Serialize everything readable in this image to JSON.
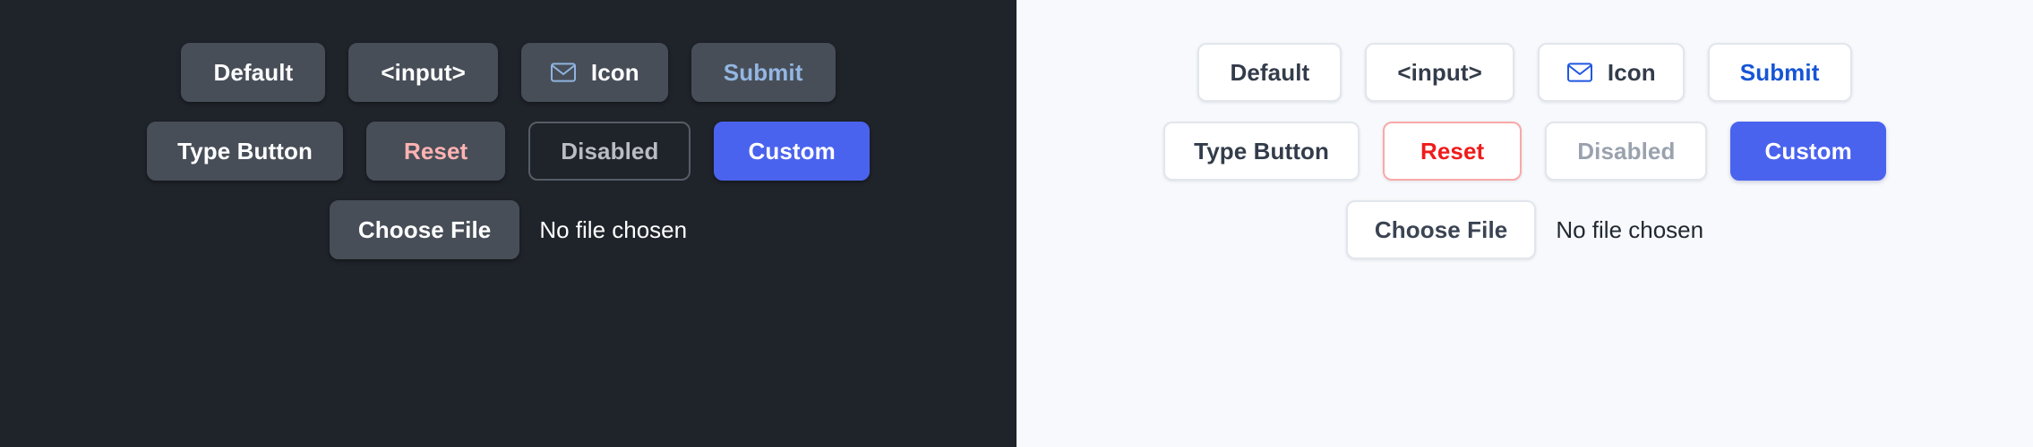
{
  "panels": [
    {
      "theme": "dark",
      "background_color": "#1f232a",
      "rows": [
        {
          "buttons": [
            {
              "label": "Default",
              "style": "solid",
              "icon": null
            },
            {
              "label": "<input>",
              "style": "solid",
              "icon": null
            },
            {
              "label": "Icon",
              "style": "solid",
              "icon": "envelope-icon",
              "icon_color": "#8fb4df"
            },
            {
              "label": "Submit",
              "style": "submit",
              "icon": null,
              "text_color": "#94b6e2"
            }
          ]
        },
        {
          "buttons": [
            {
              "label": "Type Button",
              "style": "solid",
              "icon": null
            },
            {
              "label": "Reset",
              "style": "reset",
              "icon": null,
              "text_color": "#ffb3b3"
            },
            {
              "label": "Disabled",
              "style": "disabled",
              "icon": null,
              "text_color": "#b9bcc1"
            },
            {
              "label": "Custom",
              "style": "custom",
              "icon": null,
              "background_color": "#4a63ee"
            }
          ]
        }
      ],
      "file_input": {
        "button_label": "Choose File",
        "status_text": "No file chosen"
      }
    },
    {
      "theme": "light",
      "background_color": "#f7f9fc",
      "rows": [
        {
          "buttons": [
            {
              "label": "Default",
              "style": "solid",
              "icon": null
            },
            {
              "label": "<input>",
              "style": "solid",
              "icon": null
            },
            {
              "label": "Icon",
              "style": "solid",
              "icon": "envelope-icon",
              "icon_color": "#1f57e0"
            },
            {
              "label": "Submit",
              "style": "submit",
              "icon": null,
              "text_color": "#1655d6"
            }
          ]
        },
        {
          "buttons": [
            {
              "label": "Type Button",
              "style": "solid",
              "icon": null
            },
            {
              "label": "Reset",
              "style": "reset",
              "icon": null,
              "text_color": "#f01b1b",
              "border_color": "#f9a9a9"
            },
            {
              "label": "Disabled",
              "style": "disabled",
              "icon": null,
              "text_color": "#9aa2ae"
            },
            {
              "label": "Custom",
              "style": "custom",
              "icon": null,
              "background_color": "#4a63ee"
            }
          ]
        }
      ],
      "file_input": {
        "button_label": "Choose File",
        "status_text": "No file chosen"
      }
    }
  ]
}
